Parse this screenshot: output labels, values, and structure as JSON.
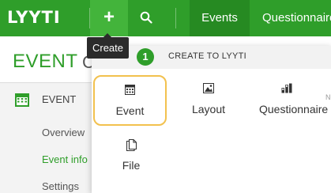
{
  "topbar": {
    "logo": "LYYTI",
    "create_icon": "plus-icon",
    "search_icon": "search-icon",
    "nav": [
      "Events",
      "Questionnaires"
    ]
  },
  "tooltip": {
    "label": "Create"
  },
  "page": {
    "title": "EVENT",
    "title_trailing": "C",
    "sidebar": {
      "heading": "EVENT",
      "links": [
        "Overview",
        "Event info",
        "Settings"
      ]
    }
  },
  "dropdown": {
    "step": "1",
    "title": "CREATE TO LYYTI",
    "items": [
      {
        "label": "Event",
        "icon": "calendar-icon"
      },
      {
        "label": "Layout",
        "icon": "image-icon"
      },
      {
        "label": "Questionnaire",
        "icon": "bar-chart-icon"
      },
      {
        "label": "File",
        "icon": "document-icon"
      }
    ],
    "edge_letter": "N"
  },
  "colors": {
    "brand_green": "#2f9e2a",
    "active_tab": "#268a22",
    "highlight": "#f2c14e"
  }
}
